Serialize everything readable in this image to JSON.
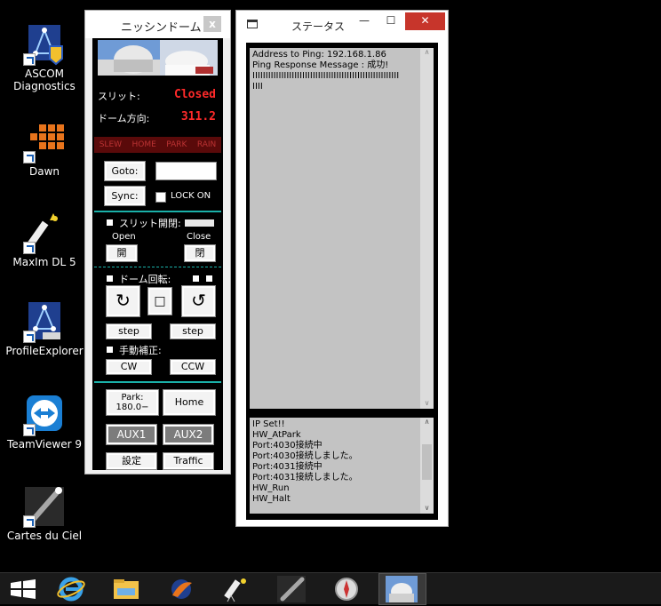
{
  "desktop": {
    "icons": [
      {
        "label": "ASCOM\nDiagnostics",
        "icon": "ascom-diagnostics-icon"
      },
      {
        "label": "Dawn",
        "icon": "dawn-icon"
      },
      {
        "label": "MaxIm DL 5",
        "icon": "maxim-telescope-icon"
      },
      {
        "label": "ProfileExplorer",
        "icon": "ascom-profile-icon"
      },
      {
        "label": "TeamViewer 9",
        "icon": "teamviewer-icon"
      },
      {
        "label": "Cartes du Ciel",
        "icon": "comet-icon"
      }
    ]
  },
  "dome_window": {
    "title": "ニッシンドーム",
    "close": "x",
    "slit_label": "スリット:",
    "slit_value": "Closed",
    "direction_label": "ドーム方向:",
    "direction_value": "311.2",
    "status_flags": [
      "SLEW",
      "HOME",
      "PARK",
      "RAIN"
    ],
    "goto_label": "Goto:",
    "goto_value": "",
    "sync_label": "Sync:",
    "lock_label": "LOCK ON",
    "slit_open_close_label": "スリット開閉:",
    "open_label": "Open",
    "close_label": "Close",
    "open_btn": "開",
    "close_btn": "閉",
    "dome_rotation_label": "ドーム回転:",
    "ccw_glyph": "↻",
    "stop_glyph": "□",
    "cw_glyph": "↺",
    "step_left": "step",
    "step_right": "step",
    "manual_label": "手動補正:",
    "cw_btn": "CW",
    "ccw_btn": "CCW",
    "park_btn_line1": "Park:",
    "park_btn_line2": "180.0−",
    "home_btn": "Home",
    "aux1_btn": "AUX1",
    "aux2_btn": "AUX2",
    "settings_btn": "設定",
    "traffic_btn": "Traffic"
  },
  "status_window": {
    "title": "ステータス",
    "min": "—",
    "max": "☐",
    "close": "✕",
    "log_top": "Address to Ping: 192.168.1.86\nPing Response Message : 成功!\nIIIIIIIIIIIIIIIIIIIIIIIIIIIIIIIIIIIIIIIIIIIIIIIIIIIIIIII\nIIII",
    "log_bottom": "IP Set!!\nHW_AtPark\nPort:4030接続中\nPort:4030接続しました。\nPort:4031接続中\nPort:4031接続しました。\nHW_Run\nHW_Halt"
  },
  "taskbar": {
    "items": [
      "windows-start-icon",
      "internet-explorer-icon",
      "file-explorer-icon",
      "firebird-app-icon",
      "telescope-app-icon",
      "comet-app-icon",
      "compass-app-icon",
      "observatory-app-icon"
    ]
  },
  "colors": {
    "accent_teal": "#1ab0a8",
    "status_red": "#ff2a2a",
    "close_red": "#c7352b"
  }
}
